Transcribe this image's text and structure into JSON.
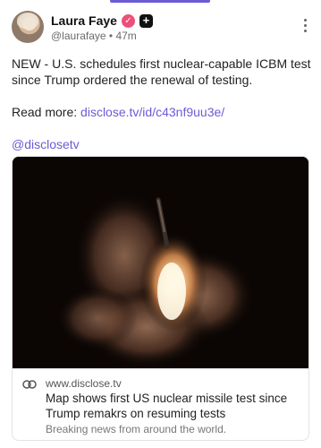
{
  "author": {
    "display_name": "Laura Faye",
    "handle": "@laurafaye",
    "separator": "•",
    "time_ago": "47m",
    "verified_icon": "checkmark-badge-icon",
    "plus_icon": "plus-badge-icon"
  },
  "post": {
    "headline": "NEW - U.S. schedules first nuclear-capable ICBM test since Trump ordered the renewal of testing.",
    "read_more_label": "Read more:",
    "read_more_link": "disclose.tv/id/c43nf9uu3e/",
    "mention": "@disclosetv"
  },
  "link_card": {
    "domain": "www.disclose.tv",
    "title": "Map shows first US nuclear missile test since Trump remakrs on resuming tests",
    "description": "Breaking news from around the world.",
    "link_icon": "link-icon"
  },
  "colors": {
    "accent": "#6b5bd6",
    "verified_badge": "#ee4f7a"
  }
}
